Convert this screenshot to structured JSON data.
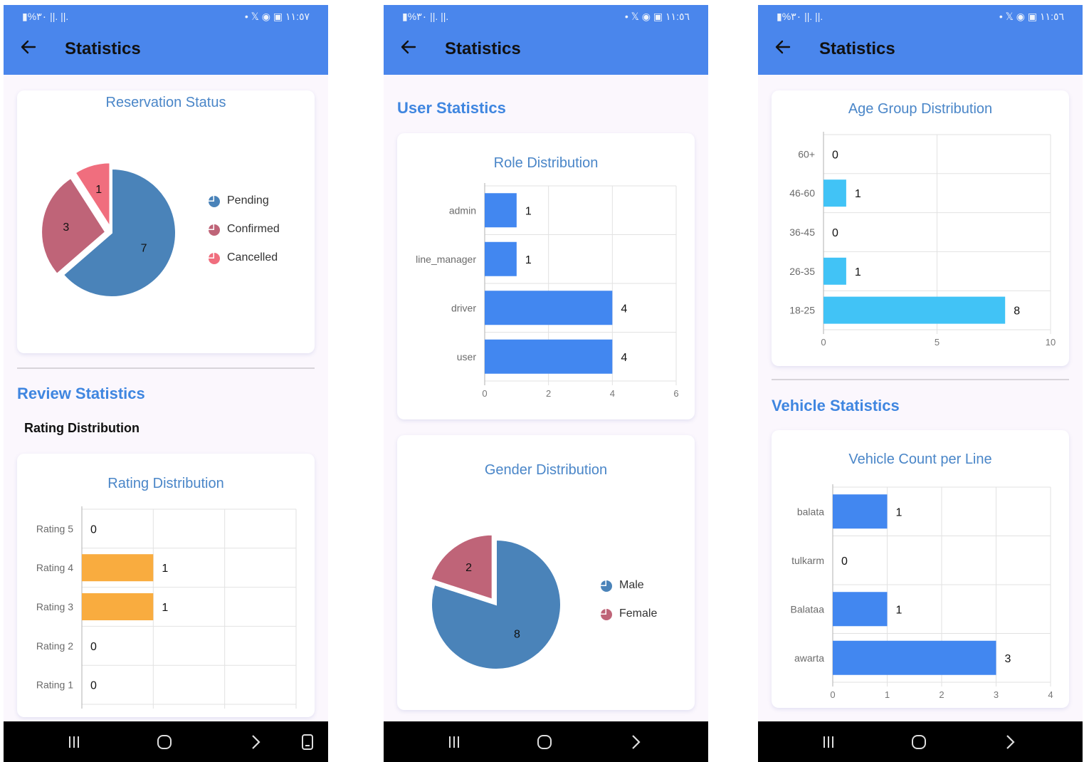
{
  "status_bar": {
    "left_text": "▮%۳۰ ||. ||.",
    "right_icons": "• 𝕏 ◉ ▣",
    "times": [
      "١١:٥٧",
      "١١:٥٦",
      "١١:٥٦"
    ]
  },
  "app": {
    "title": "Statistics",
    "icons": {
      "back": "back-arrow-icon",
      "nav": [
        "recent-apps-icon",
        "home-icon",
        "back-chevron-icon",
        "rotate-icon"
      ]
    }
  },
  "screen1": {
    "reservation_card_title": "Reservation Status",
    "review_section_title": "Review Statistics",
    "rating_subheading": "Rating Distribution",
    "rating_card_title": "Rating Distribution"
  },
  "screen2": {
    "user_section_title": "User Statistics",
    "role_card_title": "Role Distribution",
    "gender_card_title": "Gender Distribution"
  },
  "screen3": {
    "age_card_title": "Age Group Distribution",
    "vehicle_section_title": "Vehicle Statistics",
    "vehicle_card_title": "Vehicle Count per Line"
  },
  "chart_data": [
    {
      "id": "reservation",
      "type": "pie",
      "title": "Reservation Status",
      "labels": [
        "Pending",
        "Confirmed",
        "Cancelled"
      ],
      "values": [
        7,
        3,
        1
      ],
      "colors": [
        "#4a83b9",
        "#bf6478",
        "#f06e7e"
      ],
      "legend": "right"
    },
    {
      "id": "rating",
      "type": "bar",
      "orientation": "horizontal",
      "title": "Rating Distribution",
      "categories": [
        "Rating 5",
        "Rating 4",
        "Rating 3",
        "Rating 2",
        "Rating 1"
      ],
      "values": [
        0,
        1,
        1,
        0,
        0
      ],
      "color": "#f9ac3f",
      "grid": true
    },
    {
      "id": "role",
      "type": "bar",
      "orientation": "horizontal",
      "title": "Role Distribution",
      "categories": [
        "admin",
        "line_manager",
        "driver",
        "user"
      ],
      "values": [
        1,
        1,
        4,
        4
      ],
      "xlim": [
        0,
        6
      ],
      "xticks": [
        0,
        2,
        4,
        6
      ],
      "color": "#4287f0",
      "grid": true
    },
    {
      "id": "gender",
      "type": "pie",
      "title": "Gender Distribution",
      "labels": [
        "Male",
        "Female"
      ],
      "values": [
        8,
        2
      ],
      "colors": [
        "#4a83b9",
        "#bf6478"
      ],
      "legend": "right"
    },
    {
      "id": "age",
      "type": "bar",
      "orientation": "horizontal",
      "title": "Age Group Distribution",
      "categories": [
        "60+",
        "46-60",
        "36-45",
        "26-35",
        "18-25"
      ],
      "values": [
        0,
        1,
        0,
        1,
        8
      ],
      "xlim": [
        0,
        10
      ],
      "xticks": [
        0,
        5,
        10
      ],
      "color": "#41c3f6",
      "grid": true
    },
    {
      "id": "vehicle",
      "type": "bar",
      "orientation": "horizontal",
      "title": "Vehicle Count per Line",
      "categories": [
        "balata",
        "tulkarm",
        "Balataa",
        "awarta"
      ],
      "values": [
        1,
        0,
        1,
        3
      ],
      "xlim": [
        0,
        4
      ],
      "xticks": [
        0,
        1,
        2,
        3,
        4
      ],
      "color": "#4287f0",
      "grid": true
    }
  ]
}
